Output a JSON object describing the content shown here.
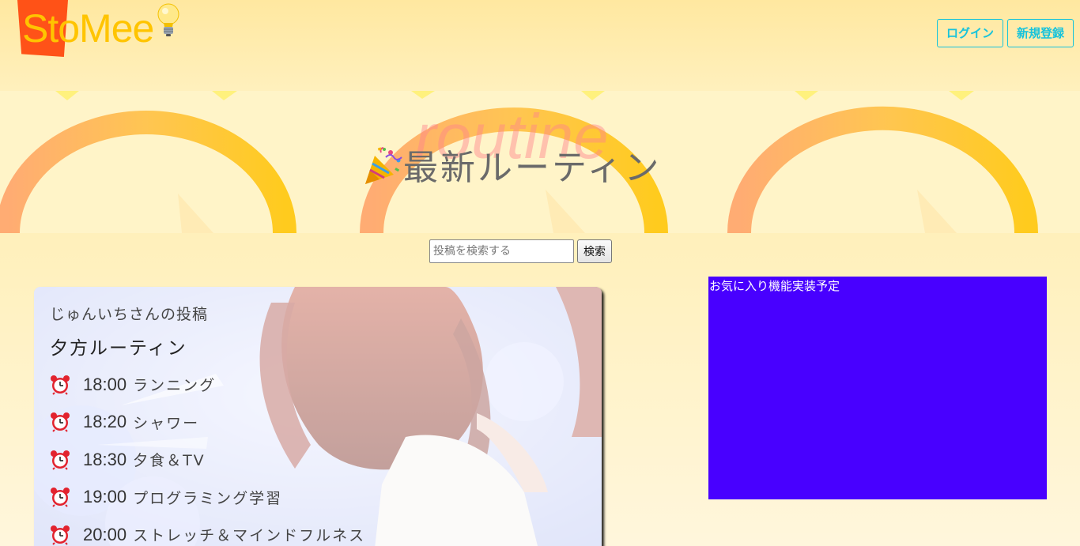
{
  "header": {
    "logo_text": "StoMee",
    "logo_icon": "lightbulb-icon",
    "login_label": "ログイン",
    "signup_label": "新規登録",
    "accent_color": "#17c3db"
  },
  "hero": {
    "watermark": "routine",
    "title": "最新ルーティン",
    "title_icon": "party-popper-icon"
  },
  "search": {
    "placeholder": "投稿を検索する",
    "button_label": "検索"
  },
  "post": {
    "author_line": "じゅんいちさんの投稿",
    "title": "夕方ルーティン",
    "items": [
      {
        "time": "18:00",
        "task": "ランニング",
        "icon": "alarm-clock-icon"
      },
      {
        "time": "18:20",
        "task": "シャワー",
        "icon": "alarm-clock-icon"
      },
      {
        "time": "18:30",
        "task": "夕食＆TV",
        "icon": "alarm-clock-icon"
      },
      {
        "time": "19:00",
        "task": "プログラミング学習",
        "icon": "alarm-clock-icon"
      },
      {
        "time": "20:00",
        "task": "ストレッチ＆マインドフルネス",
        "icon": "alarm-clock-icon"
      }
    ]
  },
  "favorites": {
    "text": "お気に入り機能実装予定",
    "background_color": "#4800ff"
  }
}
